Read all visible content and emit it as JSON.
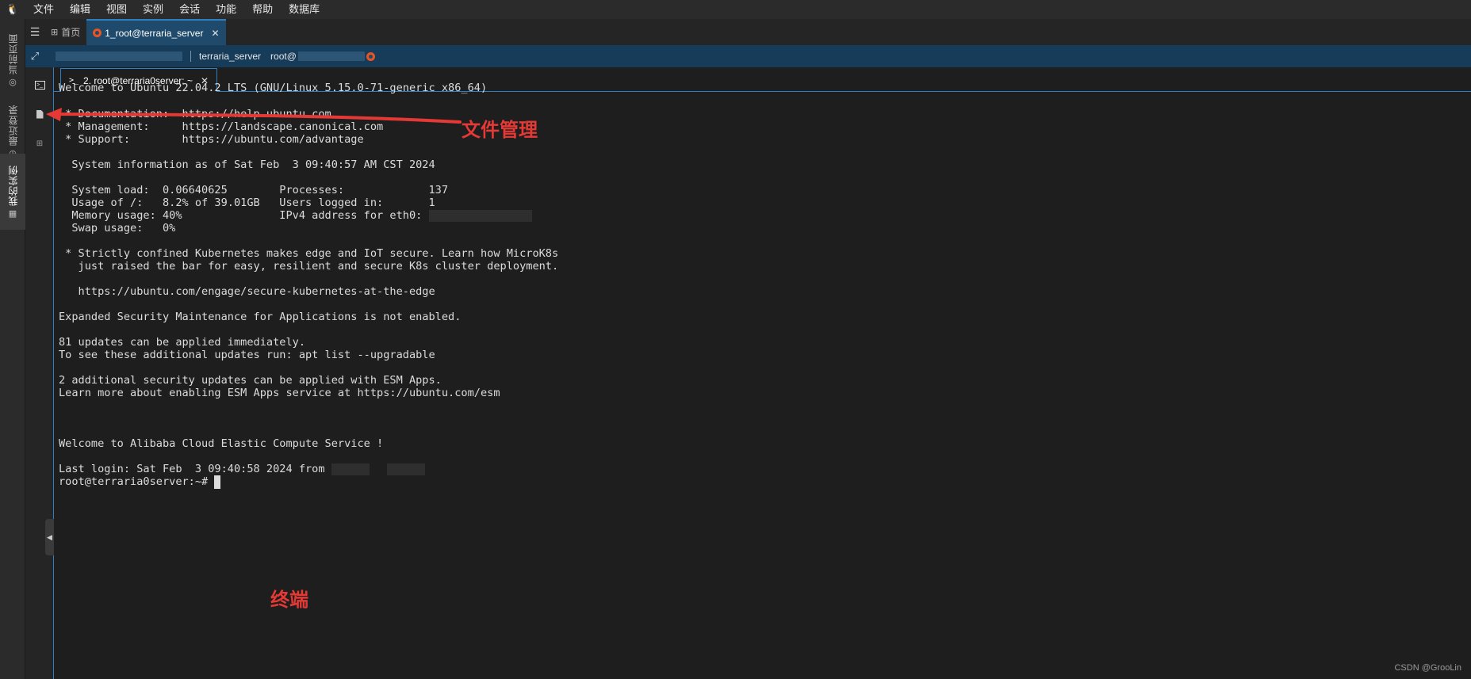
{
  "menubar": {
    "logo_icon": "tux-icon",
    "items": [
      "文件",
      "编辑",
      "视图",
      "实例",
      "会话",
      "功能",
      "帮助",
      "数据库"
    ]
  },
  "left_rail": {
    "current_page": "当前页面",
    "recent_login": "最近登录",
    "my_instances": "我的实例"
  },
  "tabs": {
    "home": "首页",
    "session": "1_root@terraria_server"
  },
  "session_bar": {
    "server_name": "terraria_server",
    "user": "root@"
  },
  "terminal_tab": {
    "label": "2. root@terraria0server: ~"
  },
  "terminal": {
    "l01": "Welcome to Ubuntu 22.04.2 LTS (GNU/Linux 5.15.0-71-generic x86_64)",
    "l02": " * Documentation:  https://help.ubuntu.com",
    "l03": " * Management:     https://landscape.canonical.com",
    "l04": " * Support:        https://ubuntu.com/advantage",
    "l05": "  System information as of Sat Feb  3 09:40:57 AM CST 2024",
    "l06": "  System load:  0.06640625        Processes:             137",
    "l07": "  Usage of /:   8.2% of 39.01GB   Users logged in:       1",
    "l08": "  Memory usage: 40%               IPv4 address for eth0: ",
    "l09": "  Swap usage:   0%",
    "l10": " * Strictly confined Kubernetes makes edge and IoT secure. Learn how MicroK8s",
    "l11": "   just raised the bar for easy, resilient and secure K8s cluster deployment.",
    "l12": "   https://ubuntu.com/engage/secure-kubernetes-at-the-edge",
    "l13": "Expanded Security Maintenance for Applications is not enabled.",
    "l14": "81 updates can be applied immediately.",
    "l15": "To see these additional updates run: apt list --upgradable",
    "l16": "2 additional security updates can be applied with ESM Apps.",
    "l17": "Learn more about enabling ESM Apps service at https://ubuntu.com/esm",
    "l18": "Welcome to Alibaba Cloud Elastic Compute Service !",
    "l19": "Last login: Sat Feb  3 09:40:58 2024 from ",
    "l20": "root@terraria0server:~# "
  },
  "annotations": {
    "file_manager": "文件管理",
    "terminal": "终端",
    "color": "#e53935"
  },
  "watermark": "CSDN @GrooLin",
  "colors": {
    "accent": "#2d7fc1",
    "session_bar": "#173c5a",
    "active_tab": "#1f4a6b",
    "ubuntu": "#e95420"
  }
}
